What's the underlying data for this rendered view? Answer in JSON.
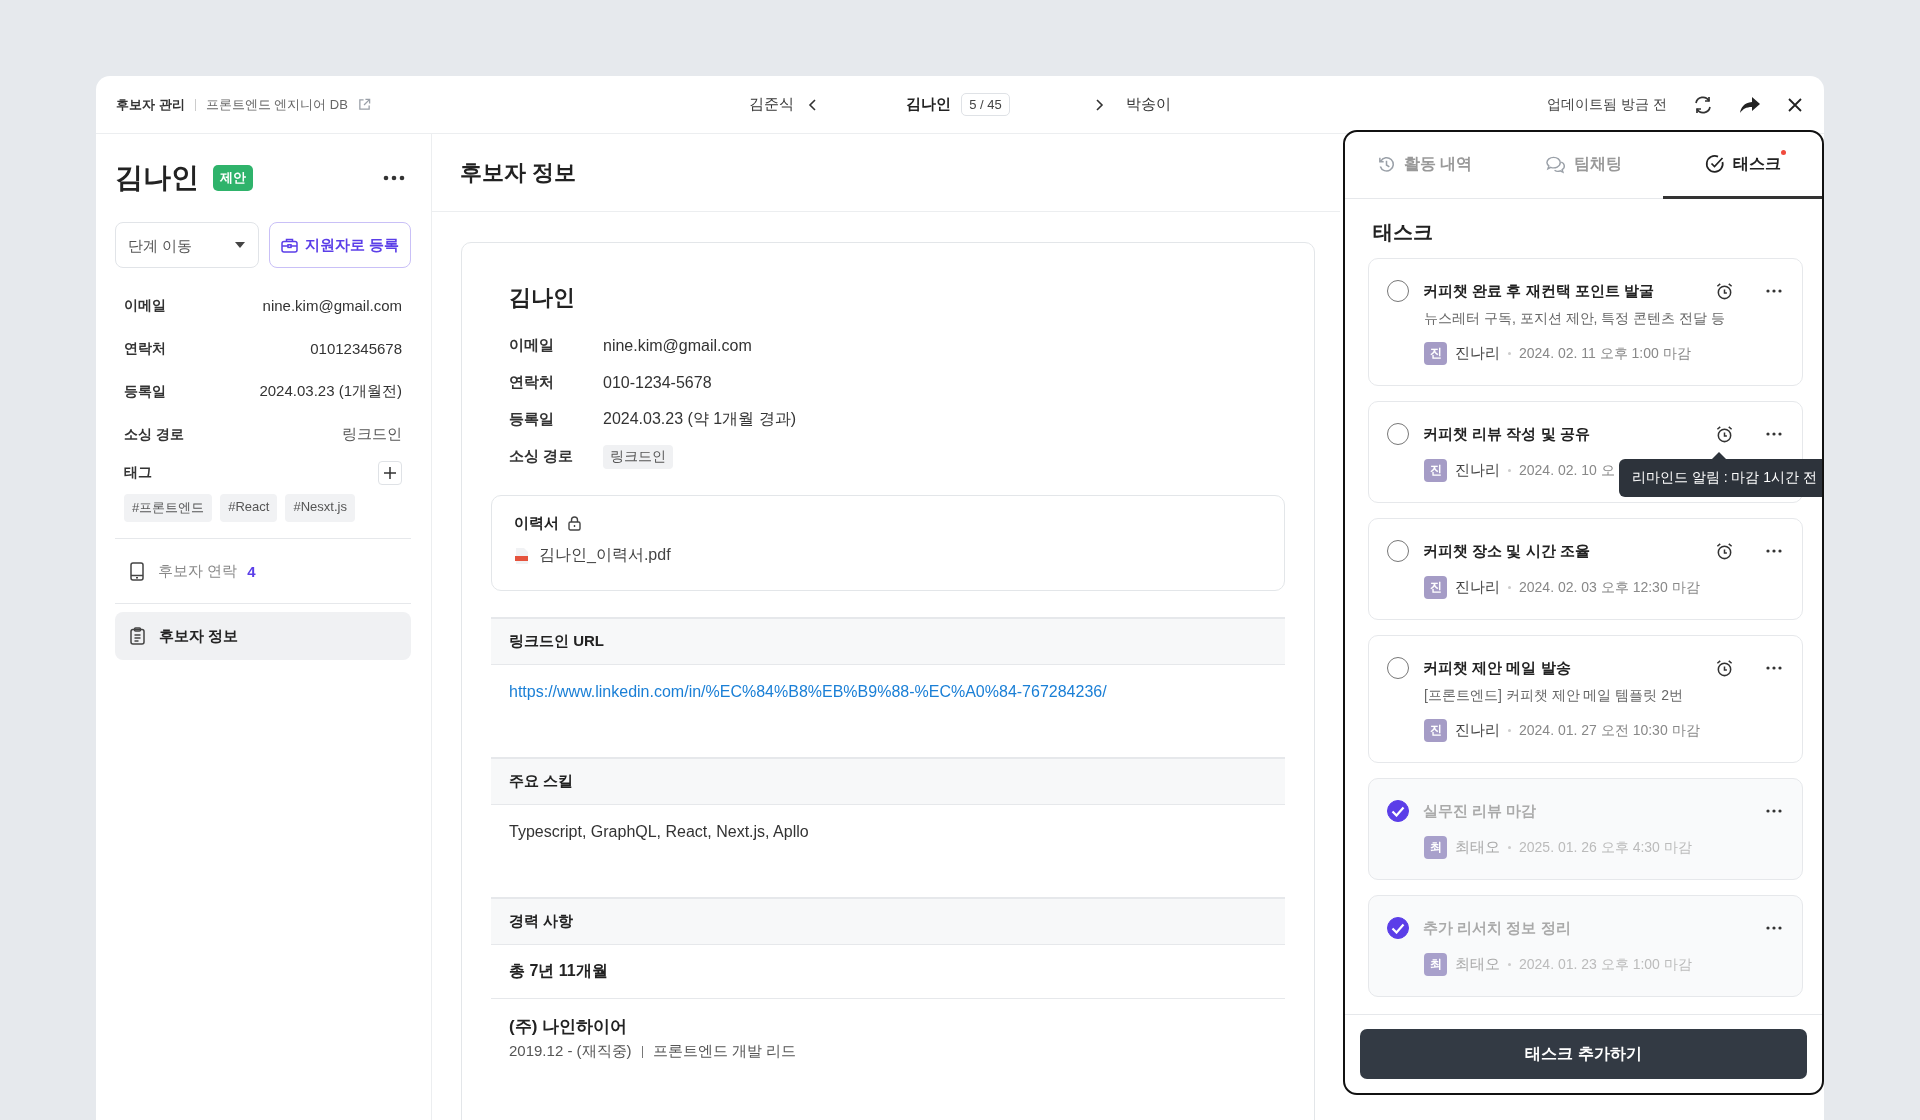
{
  "breadcrumb": [
    {
      "label": "후보자 관리"
    },
    {
      "label": "프론트엔드 엔지니어 DB",
      "external": true
    }
  ],
  "navigator": {
    "prev": "김준식",
    "current": "김나인",
    "position": "5 / 45",
    "next": "박송이"
  },
  "header_actions": {
    "updated": "업데이트됨 방금 전"
  },
  "sidebar": {
    "name": "김나인",
    "stage_badge": "제안",
    "stage_select": {
      "placeholder": "단계 이동"
    },
    "register_button": "지원자로 등록",
    "fields": [
      {
        "label": "이메일",
        "value": "nine.kim@gmail.com"
      },
      {
        "label": "연락처",
        "value": "01012345678"
      },
      {
        "label": "등록일",
        "value": "2024.03.23 (1개월전)"
      },
      {
        "label": "소싱 경로",
        "value": "링크드인",
        "muted": true
      }
    ],
    "tags_label": "태그",
    "tags": [
      "#프론트엔드",
      "#React",
      "#Nesxt.js"
    ],
    "menu": [
      {
        "kind": "contact",
        "label": "후보자 연락",
        "count": "4",
        "selected": false
      },
      {
        "kind": "info",
        "label": "후보자 정보",
        "selected": true
      }
    ]
  },
  "main": {
    "title": "후보자 정보",
    "profile": {
      "name": "김나인",
      "fields": [
        {
          "kind": "text",
          "label": "이메일",
          "value": "nine.kim@gmail.com"
        },
        {
          "kind": "text",
          "label": "연락처",
          "value": "010-1234-5678"
        },
        {
          "kind": "text",
          "label": "등록일",
          "value": "2024.03.23 (약 1개월 경과)"
        },
        {
          "kind": "tag",
          "label": "소싱 경로",
          "value": "링크드인"
        }
      ]
    },
    "resume": {
      "label": "이력서",
      "locked": true,
      "file": "김나인_이력서.pdf"
    },
    "sections": [
      {
        "kind": "link",
        "title": "링크드인 URL",
        "text": "https://www.linkedin.com/in/%EC%84%B8%EB%B9%88-%EC%A0%84-767284236/"
      },
      {
        "kind": "text",
        "title": "주요 스킬",
        "text": "Typescript, GraphQL, React, Next.js, Apllo"
      },
      {
        "kind": "career",
        "title": "경력 사항",
        "total": "총 7년 11개월",
        "company": "(주) 나인하이어",
        "period": "2019.12 - (재직중)",
        "role": "프론트엔드 개발 리드"
      }
    ]
  },
  "panel": {
    "tabs": [
      {
        "kind": "history",
        "label": "활동 내역",
        "selected": false,
        "notification": false
      },
      {
        "kind": "chat",
        "label": "팀채팅",
        "selected": false,
        "notification": false
      },
      {
        "kind": "task",
        "label": "태스크",
        "selected": true,
        "notification": true
      }
    ],
    "heading": "태스크",
    "tasks": [
      {
        "title": "커피챗 완료 후 재컨택 포인트 발굴",
        "description": "뉴스레터 구독, 포지션 제안, 특정 콘텐츠 전달 등",
        "initial": "진",
        "assignee": "진나리",
        "due": "2024. 02. 11 오후 1:00 마감",
        "done": false,
        "reminder": true
      },
      {
        "title": "커피챗 리뷰 작성 및 공유",
        "initial": "진",
        "assignee": "진나리",
        "due": "2024. 02. 10 오",
        "done": false,
        "reminder": true,
        "tooltip": "리마인드 알림 : 마감 1시간 전"
      },
      {
        "title": "커피챗 장소 및 시간 조율",
        "initial": "진",
        "assignee": "진나리",
        "due": "2024. 02. 03 오후 12:30 마감",
        "done": false,
        "reminder": true
      },
      {
        "title": "커피챗 제안 메일 발송",
        "description": "[프론트엔드] 커피챗 제안 메일 템플릿 2번",
        "initial": "진",
        "assignee": "진나리",
        "due": "2024. 01. 27 오전 10:30 마감",
        "done": false,
        "reminder": true
      },
      {
        "title": "실무진 리뷰 마감",
        "initial": "최",
        "assignee": "최태오",
        "due": "2025. 01. 26  오후 4:30 마감",
        "done": true,
        "reminder": false
      },
      {
        "title": "추가 리서치 정보 정리",
        "initial": "최",
        "assignee": "최태오",
        "due": "2024. 01. 23  오후 1:00 마감",
        "done": true,
        "reminder": false
      }
    ],
    "add_button": "태스크 추가하기"
  }
}
